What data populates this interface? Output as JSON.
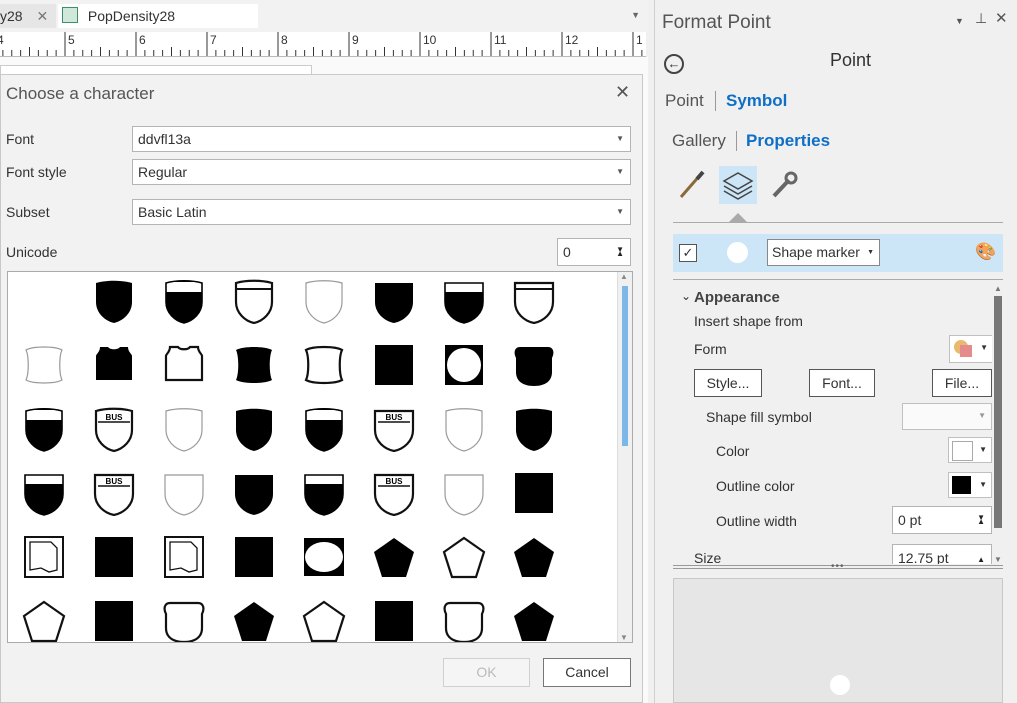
{
  "tabs": [
    {
      "label": "y28",
      "active": false
    },
    {
      "label": "PopDensity28",
      "active": true
    }
  ],
  "ruler": {
    "numbers": [
      "4",
      "5",
      "6",
      "7",
      "8",
      "9",
      "10",
      "11",
      "12",
      "1"
    ]
  },
  "dialog": {
    "title": "Choose a character",
    "font_label": "Font",
    "font_value": "ddvfl13a",
    "style_label": "Font style",
    "style_value": "Regular",
    "subset_label": "Subset",
    "subset_value": "Basic Latin",
    "unicode_label": "Unicode",
    "unicode_value": "0",
    "bus_text": "BUS",
    "ok_label": "OK",
    "cancel_label": "Cancel"
  },
  "pane": {
    "title": "Format Point",
    "heading": "Point",
    "breadcrumb_1": "Point",
    "breadcrumb_2": "Symbol",
    "subtab_1": "Gallery",
    "subtab_2": "Properties",
    "layer_dropdown": "Shape marker",
    "section": "Appearance",
    "insert_from": "Insert shape from",
    "form_label": "Form",
    "style_btn": "Style...",
    "font_btn": "Font...",
    "file_btn": "File...",
    "shape_fill_label": "Shape fill symbol",
    "color_label": "Color",
    "outline_color_label": "Outline color",
    "outline_width_label": "Outline width",
    "outline_width_value": "0 pt",
    "size_label": "Size",
    "size_value": "12.75 pt",
    "accent": "#0f6fc6",
    "selected_row_bg": "#cde6f7"
  }
}
